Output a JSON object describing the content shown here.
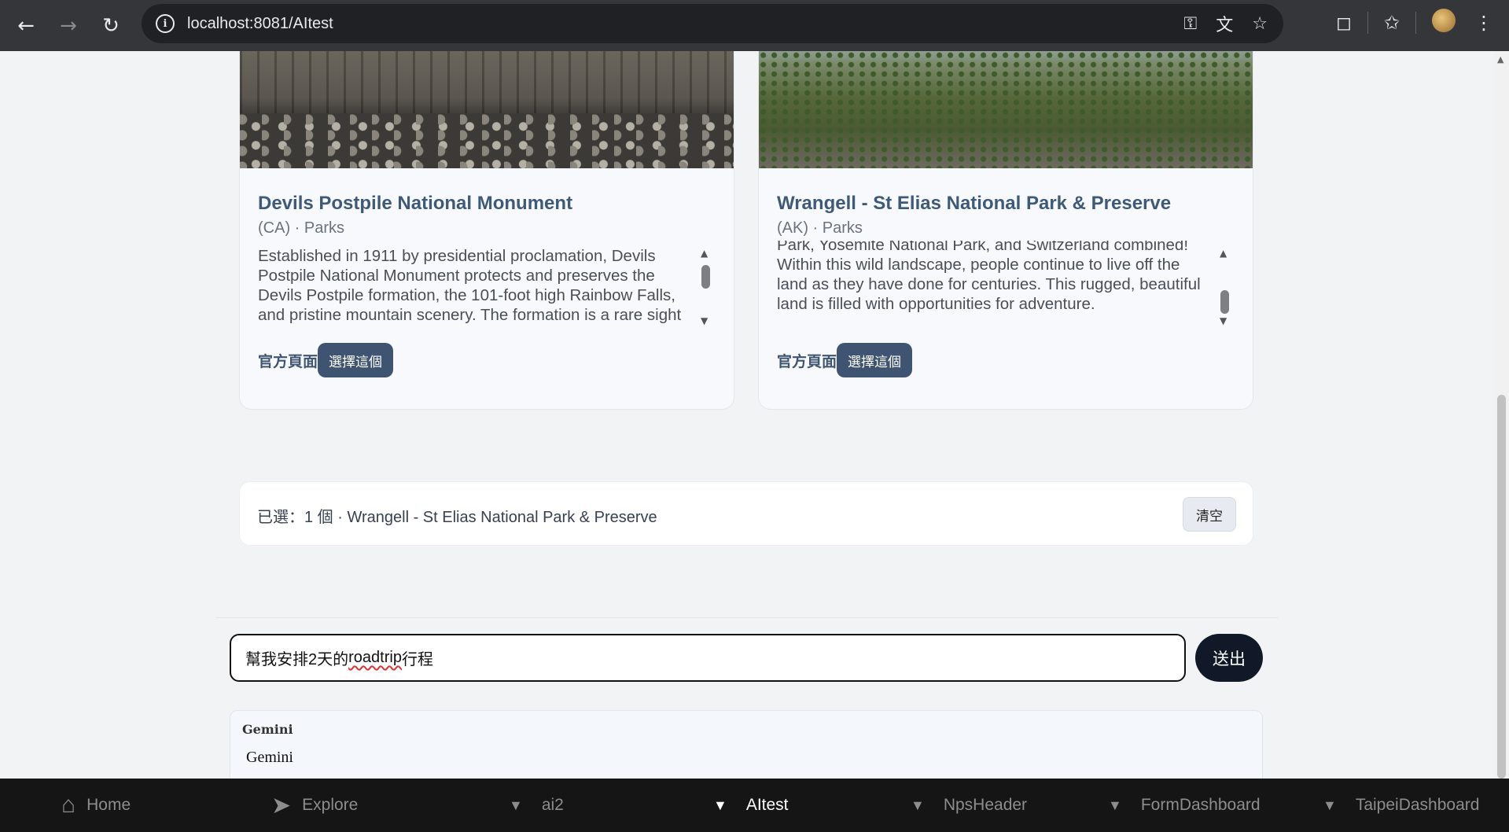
{
  "browser": {
    "url": "localhost:8081/AItest",
    "icons": [
      "back-icon",
      "forward-icon",
      "reload-icon",
      "site-info-icon",
      "key-icon",
      "translate-icon",
      "bookmark-star-icon",
      "extensions-icon",
      "favorites-icon",
      "profile-avatar",
      "more-menu-icon"
    ]
  },
  "cards": [
    {
      "title": "Devils Postpile National Monument",
      "subtitle": "(CA) · Parks",
      "description": "Established in 1911 by presidential proclamation, Devils Postpile National Monument protects and preserves the Devils Postpile formation, the 101-foot high Rainbow Falls, and pristine mountain scenery. The formation is a rare sight in the geologic world and ranks as one of the",
      "official_label": "官方頁面",
      "choose_label": "選擇這個"
    },
    {
      "title": "Wrangell - St Elias National Park & Preserve",
      "subtitle": "(AK) · Parks",
      "description": "Park, Yosemite National Park, and Switzerland combined! Within this wild landscape, people continue to live off the land as they have done for centuries. This rugged, beautiful land is filled with opportunities for adventure.",
      "official_label": "官方頁面",
      "choose_label": "選擇這個"
    }
  ],
  "selection": {
    "text": "已選：1 個 · Wrangell - St Elias National Park & Preserve",
    "clear_label": "清空"
  },
  "chat": {
    "input_before": "幫我安排2天的",
    "input_typo": "roadtrip",
    "input_after": "行程",
    "send_label": "送出",
    "response_label": "Gemini",
    "response_text": "Gemini"
  },
  "bottom_nav": [
    {
      "label": "Home",
      "icon": "home-icon",
      "active": false
    },
    {
      "label": "Explore",
      "icon": "send-icon",
      "active": false
    },
    {
      "label": "ai2",
      "icon": "caret-down-icon",
      "active": false
    },
    {
      "label": "AItest",
      "icon": "caret-down-icon",
      "active": true
    },
    {
      "label": "NpsHeader",
      "icon": "caret-down-icon",
      "active": false
    },
    {
      "label": "FormDashboard",
      "icon": "caret-down-icon",
      "active": false
    },
    {
      "label": "TaipeiDashboard",
      "icon": "caret-down-icon",
      "active": false
    }
  ]
}
